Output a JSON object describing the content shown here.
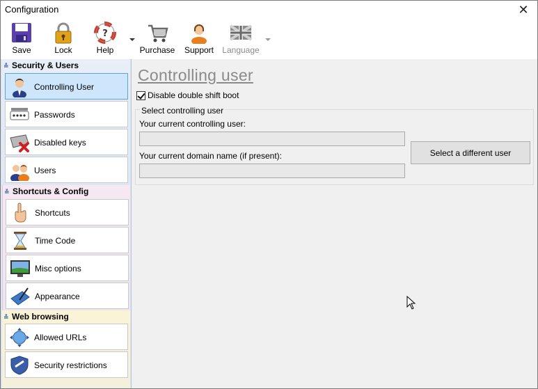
{
  "window": {
    "title": "Configuration",
    "close_glyph": "✕"
  },
  "toolbar": {
    "items": [
      {
        "label": "Save",
        "icon": "floppy-disk-icon"
      },
      {
        "label": "Lock",
        "icon": "padlock-icon"
      },
      {
        "label": "Help",
        "icon": "lifebuoy-icon"
      },
      {
        "label": "Purchase",
        "icon": "shopping-cart-icon"
      },
      {
        "label": "Support",
        "icon": "support-agent-icon"
      },
      {
        "label": "Language",
        "icon": "uk-flag-icon",
        "disabled": true
      }
    ]
  },
  "sidebar": {
    "groups": [
      {
        "title": "Security & Users",
        "items": [
          {
            "label": "Controlling User",
            "icon": "user-tie-icon",
            "active": true
          },
          {
            "label": "Passwords",
            "icon": "password-keys-icon"
          },
          {
            "label": "Disabled keys",
            "icon": "keyboard-disabled-icon"
          },
          {
            "label": "Users",
            "icon": "users-icon"
          }
        ]
      },
      {
        "title": "Shortcuts & Config",
        "items": [
          {
            "label": "Shortcuts",
            "icon": "hand-pointer-icon"
          },
          {
            "label": "Time Code",
            "icon": "hourglass-icon"
          },
          {
            "label": "Misc options",
            "icon": "monitor-landscape-icon"
          },
          {
            "label": "Appearance",
            "icon": "pen-tablet-icon"
          }
        ]
      },
      {
        "title": "Web browsing",
        "items": [
          {
            "label": "Allowed URLs",
            "icon": "globe-arrows-icon"
          },
          {
            "label": "Security restrictions",
            "icon": "shield-icon"
          }
        ]
      }
    ]
  },
  "main": {
    "title": "Controlling user",
    "checkbox_label": "Disable double shift boot",
    "checkbox_checked": true,
    "group_label": "Select controlling user",
    "current_user_label": "Your current controlling user:",
    "current_user_value": "",
    "domain_label": "Your current domain name (if present):",
    "domain_value": "",
    "select_button": "Select a different user"
  }
}
